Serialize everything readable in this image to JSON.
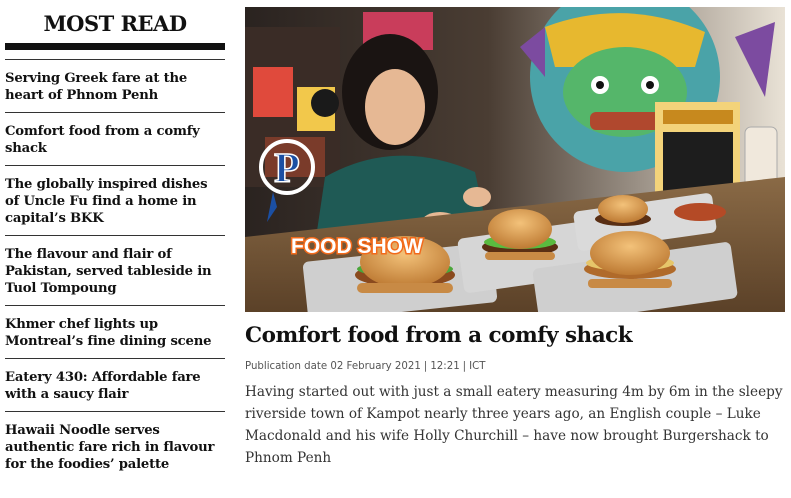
{
  "sidebar": {
    "title": "MOST READ",
    "items": [
      {
        "label": "Serving Greek fare at the heart of Phnom Penh"
      },
      {
        "label": "Comfort food from a comfy shack"
      },
      {
        "label": "The globally inspired dishes of Uncle Fu find a home in capital’s BKK"
      },
      {
        "label": "The flavour and flair of Pakistan, served tableside in Tuol Tompoung"
      },
      {
        "label": "Khmer chef lights up Montreal’s fine dining scene"
      },
      {
        "label": "Eatery 430: Affordable fare with a saucy flair"
      },
      {
        "label": "Hawaii Noodle serves authentic fare rich in flavour for the foodies’ palette"
      }
    ]
  },
  "article": {
    "image_overlay_text": "FOOD SHOW",
    "image_logo_letter": "P",
    "headline": "Comfort food from a comfy shack",
    "publication_label": "Publication date 02 February 2021",
    "time": "12:21",
    "timezone": "ICT",
    "summary": "Having started out with just a small eatery measuring 4m by 6m in the sleepy riverside town of Kampot nearly three years ago, an English couple – Luke Macdonald and his wife Holly Churchill – have now brought Burgershack to Phnom Penh"
  },
  "colors": {
    "text": "#111111",
    "overlay_orange": "#f26a1b",
    "logo_blue": "#1b4fa3"
  }
}
